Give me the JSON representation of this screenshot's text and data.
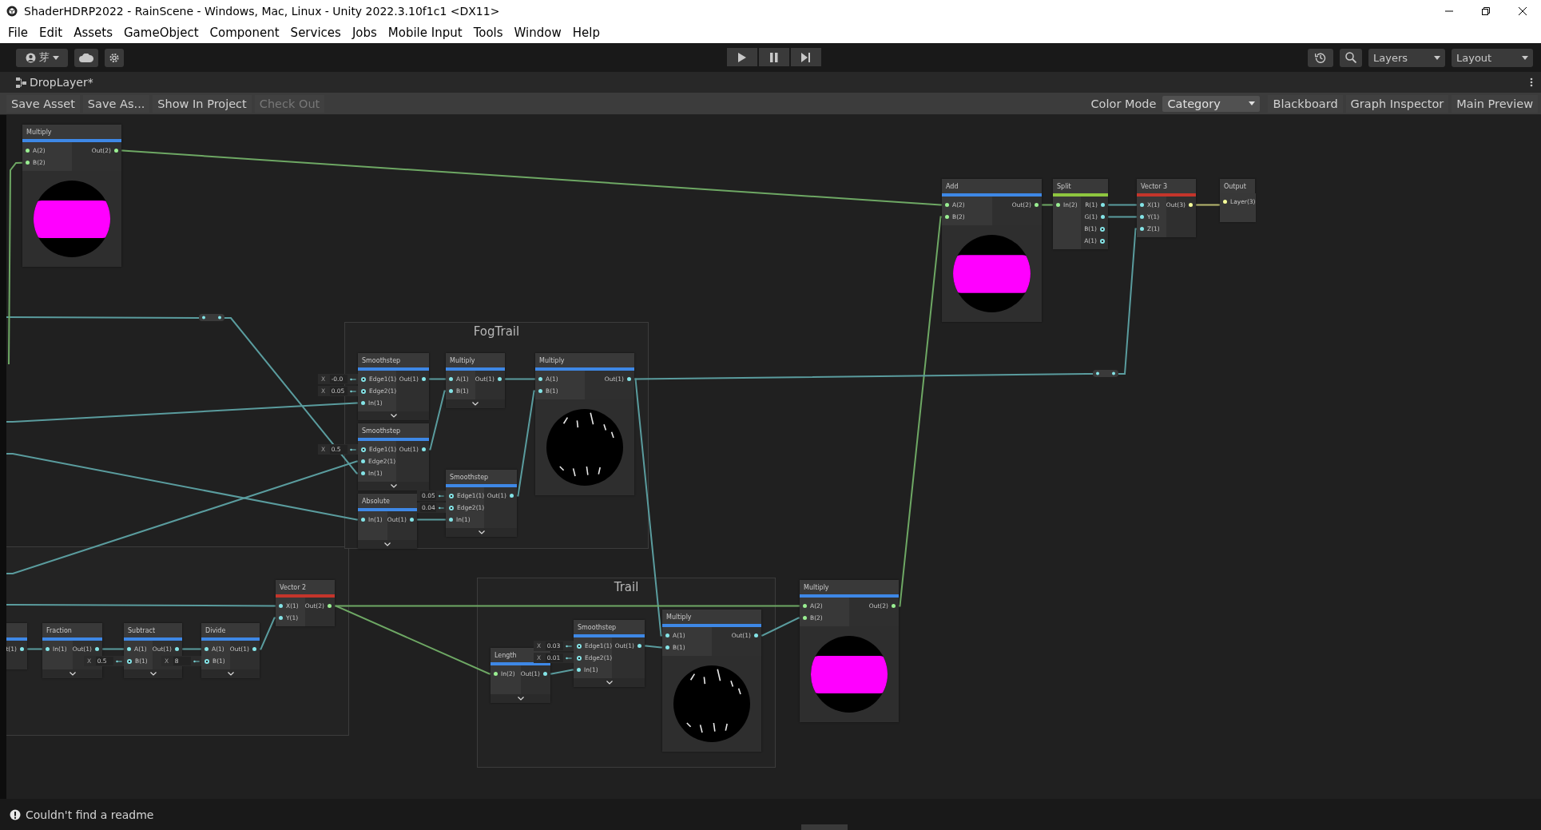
{
  "window": {
    "title": "ShaderHDRP2022 - RainScene - Windows, Mac, Linux - Unity 2022.3.10f1c1 <DX11>"
  },
  "menu": [
    "File",
    "Edit",
    "Assets",
    "GameObject",
    "Component",
    "Services",
    "Jobs",
    "Mobile Input",
    "Tools",
    "Window",
    "Help"
  ],
  "toolbar": {
    "account": "芽",
    "layers": "Layers",
    "layout": "Layout"
  },
  "tab": {
    "title": "DropLayer*"
  },
  "graph_toolbar": {
    "buttons": [
      {
        "label": "Save Asset",
        "disabled": false
      },
      {
        "label": "Save As...",
        "disabled": false
      },
      {
        "label": "Show In Project",
        "disabled": false
      },
      {
        "label": "Check Out",
        "disabled": true
      }
    ],
    "color_mode_label": "Color Mode",
    "color_mode": "Category",
    "toggles": [
      "Blackboard",
      "Graph Inspector",
      "Main Preview"
    ]
  },
  "groups": [
    {
      "title": "FogTrail"
    },
    {
      "title": "Trail"
    }
  ],
  "nodes": [
    {
      "kind": "band",
      "title": "Multiply",
      "color": "#3e88e6",
      "inputs": [
        {
          "label": "A(2)",
          "color": "#9aef92",
          "connected": true
        },
        {
          "label": "B(2)",
          "color": "#9aef92",
          "connected": true
        }
      ],
      "outputs": [
        {
          "label": "Out(2)",
          "color": "#9aef92",
          "connected": true
        }
      ],
      "expandable": false
    },
    {
      "kind": "band",
      "title": "Add",
      "color": "#3e88e6",
      "inputs": [
        {
          "label": "A(2)",
          "color": "#9aef92",
          "connected": true
        },
        {
          "label": "B(2)",
          "color": "#9aef92",
          "connected": true
        }
      ],
      "outputs": [
        {
          "label": "Out(2)",
          "color": "#9aef92",
          "connected": true
        }
      ],
      "expandable": false
    },
    {
      "kind": "plain",
      "title": "Split",
      "color": "#8ec63f",
      "inputs": [
        {
          "label": "In(2)",
          "color": "#9aef92",
          "connected": true
        }
      ],
      "outputs": [
        {
          "label": "R(1)",
          "color": "#84e4e7",
          "connected": true
        },
        {
          "label": "G(1)",
          "color": "#84e4e7",
          "connected": true
        },
        {
          "label": "B(1)",
          "color": "#84e4e7",
          "connected": false
        },
        {
          "label": "A(1)",
          "color": "#84e4e7",
          "connected": false
        }
      ],
      "expandable": false
    },
    {
      "kind": "plain",
      "title": "Vector 3",
      "color": "#c4352b",
      "inputs": [
        {
          "label": "X(1)",
          "color": "#84e4e7",
          "connected": true
        },
        {
          "label": "Y(1)",
          "color": "#84e4e7",
          "connected": true
        },
        {
          "label": "Z(1)",
          "color": "#84e4e7",
          "connected": true
        }
      ],
      "outputs": [
        {
          "label": "Out(3)",
          "color": "#f6ff9a",
          "connected": true
        }
      ],
      "expandable": false
    },
    {
      "kind": "plain",
      "title": "Output",
      "inputs": [
        {
          "label": "Layer(3)",
          "color": "#f6ff9a",
          "connected": true
        }
      ],
      "expandable": false
    },
    {
      "kind": "plain",
      "title": "Smoothstep",
      "color": "#3e88e6",
      "inputs": [
        {
          "label": "Edge1(1)",
          "color": "#84e4e7",
          "connected": false,
          "field": {
            "axis": "X",
            "value": "-0.0"
          }
        },
        {
          "label": "Edge2(1)",
          "color": "#84e4e7",
          "connected": false,
          "field": {
            "axis": "X",
            "value": "0.05"
          }
        },
        {
          "label": "In(1)",
          "color": "#84e4e7",
          "connected": true
        }
      ],
      "outputs": [
        {
          "label": "Out(1)",
          "color": "#84e4e7",
          "connected": true
        }
      ],
      "expandable": true
    },
    {
      "kind": "plain",
      "title": "Multiply",
      "color": "#3e88e6",
      "inputs": [
        {
          "label": "A(1)",
          "color": "#84e4e7",
          "connected": true
        },
        {
          "label": "B(1)",
          "color": "#84e4e7",
          "connected": true
        }
      ],
      "outputs": [
        {
          "label": "Out(1)",
          "color": "#84e4e7",
          "connected": true
        }
      ],
      "expandable": true
    },
    {
      "kind": "streaks",
      "title": "Multiply",
      "color": "#3e88e6",
      "inputs": [
        {
          "label": "A(1)",
          "color": "#84e4e7",
          "connected": true
        },
        {
          "label": "B(1)",
          "color": "#84e4e7",
          "connected": true
        }
      ],
      "outputs": [
        {
          "label": "Out(1)",
          "color": "#84e4e7",
          "connected": true
        }
      ],
      "expandable": false
    },
    {
      "kind": "plain",
      "title": "Smoothstep",
      "color": "#3e88e6",
      "inputs": [
        {
          "label": "Edge1(1)",
          "color": "#84e4e7",
          "connected": false,
          "field": {
            "axis": "X",
            "value": "0.5"
          }
        },
        {
          "label": "Edge2(1)",
          "color": "#84e4e7",
          "connected": true
        },
        {
          "label": "In(1)",
          "color": "#84e4e7",
          "connected": true
        }
      ],
      "outputs": [
        {
          "label": "Out(1)",
          "color": "#84e4e7",
          "connected": true
        }
      ],
      "expandable": true
    },
    {
      "kind": "plain",
      "title": "Absolute",
      "color": "#3e88e6",
      "inputs": [
        {
          "label": "In(1)",
          "color": "#84e4e7",
          "connected": true
        }
      ],
      "outputs": [
        {
          "label": "Out(1)",
          "color": "#84e4e7",
          "connected": true
        }
      ],
      "expandable": true
    },
    {
      "kind": "plain",
      "title": "Smoothstep",
      "color": "#3e88e6",
      "inputs": [
        {
          "label": "Edge1(1)",
          "color": "#84e4e7",
          "connected": false,
          "field": {
            "value": "0.05"
          }
        },
        {
          "label": "Edge2(1)",
          "color": "#84e4e7",
          "connected": false,
          "field": {
            "value": "0.04"
          }
        },
        {
          "label": "In(1)",
          "color": "#84e4e7",
          "connected": true
        }
      ],
      "outputs": [
        {
          "label": "Out(1)",
          "color": "#84e4e7",
          "connected": true
        }
      ],
      "expandable": true
    },
    {
      "kind": "plain",
      "title": "Vector 2",
      "color": "#c4352b",
      "inputs": [
        {
          "label": "X(1)",
          "color": "#84e4e7",
          "connected": true
        },
        {
          "label": "Y(1)",
          "color": "#84e4e7",
          "connected": true
        }
      ],
      "outputs": [
        {
          "label": "Out(2)",
          "color": "#9aef92",
          "connected": true
        }
      ],
      "expandable": false
    },
    {
      "kind": "plain",
      "color": "#3e88e6",
      "outputs": [
        {
          "label": "t(1)",
          "color": "#84e4e7",
          "connected": true
        }
      ],
      "expandable": false
    },
    {
      "kind": "plain",
      "title": "Fraction",
      "color": "#3e88e6",
      "inputs": [
        {
          "label": "In(1)",
          "color": "#84e4e7",
          "connected": true
        }
      ],
      "outputs": [
        {
          "label": "Out(1)",
          "color": "#84e4e7",
          "connected": true
        }
      ],
      "expandable": true
    },
    {
      "kind": "plain",
      "title": "Subtract",
      "color": "#3e88e6",
      "inputs": [
        {
          "label": "A(1)",
          "color": "#84e4e7",
          "connected": true
        },
        {
          "label": "B(1)",
          "color": "#84e4e7",
          "connected": false,
          "field": {
            "axis": "X",
            "value": "0.5"
          }
        }
      ],
      "outputs": [
        {
          "label": "Out(1)",
          "color": "#84e4e7",
          "connected": true
        }
      ],
      "expandable": true
    },
    {
      "kind": "plain",
      "title": "Divide",
      "color": "#3e88e6",
      "inputs": [
        {
          "label": "A(1)",
          "color": "#84e4e7",
          "connected": true
        },
        {
          "label": "B(1)",
          "color": "#84e4e7",
          "connected": false,
          "field": {
            "axis": "X",
            "value": "8"
          }
        }
      ],
      "outputs": [
        {
          "label": "Out(1)",
          "color": "#84e4e7",
          "connected": true
        }
      ],
      "expandable": true
    },
    {
      "kind": "plain",
      "title": "Length",
      "color": "#3e88e6",
      "inputs": [
        {
          "label": "In(2)",
          "color": "#9aef92",
          "connected": true
        }
      ],
      "outputs": [
        {
          "label": "Out(1)",
          "color": "#84e4e7",
          "connected": true
        }
      ],
      "expandable": true
    },
    {
      "kind": "plain",
      "title": "Smoothstep",
      "color": "#3e88e6",
      "inputs": [
        {
          "label": "Edge1(1)",
          "color": "#84e4e7",
          "connected": false,
          "field": {
            "axis": "X",
            "value": "0.03"
          }
        },
        {
          "label": "Edge2(1)",
          "color": "#84e4e7",
          "connected": false,
          "field": {
            "axis": "X",
            "value": "0.01"
          }
        },
        {
          "label": "In(1)",
          "color": "#84e4e7",
          "connected": true
        }
      ],
      "outputs": [
        {
          "label": "Out(1)",
          "color": "#84e4e7",
          "connected": true
        }
      ],
      "expandable": true
    },
    {
      "kind": "streaks",
      "title": "Multiply",
      "color": "#3e88e6",
      "inputs": [
        {
          "label": "A(1)",
          "color": "#84e4e7",
          "connected": true
        },
        {
          "label": "B(1)",
          "color": "#84e4e7",
          "connected": true
        }
      ],
      "outputs": [
        {
          "label": "Out(1)",
          "color": "#84e4e7",
          "connected": true
        }
      ],
      "expandable": false
    },
    {
      "kind": "band",
      "title": "Multiply",
      "color": "#3e88e6",
      "inputs": [
        {
          "label": "A(2)",
          "color": "#9aef92",
          "connected": true
        },
        {
          "label": "B(2)",
          "color": "#9aef92",
          "connected": true
        }
      ],
      "outputs": [
        {
          "label": "Out(2)",
          "color": "#9aef92",
          "connected": true
        }
      ],
      "expandable": false
    }
  ],
  "status_bar": {
    "message": "Couldn't find a readme"
  }
}
